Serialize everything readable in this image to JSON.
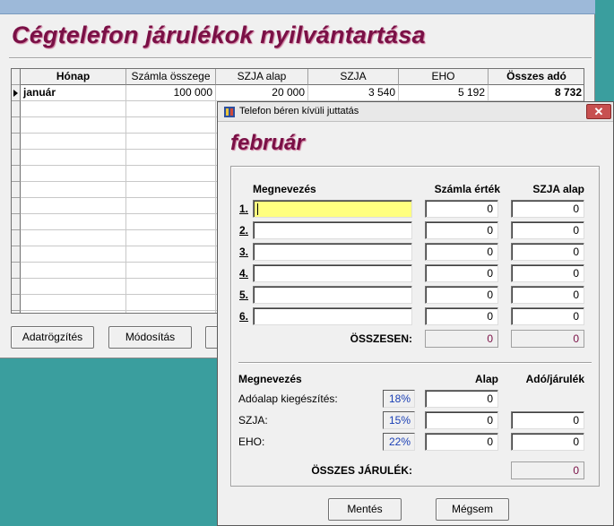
{
  "main": {
    "title": "Cégtelefon járulékok nyilvántartása",
    "columns": [
      "Hónap",
      "Számla összege",
      "SZJA alap",
      "SZJA",
      "EHO",
      "Összes adó"
    ],
    "rows": [
      {
        "honap": "január",
        "szamla": "100 000",
        "szja_alap": "20 000",
        "szja": "3 540",
        "eho": "5 192",
        "osszes": "8 732"
      }
    ],
    "buttons": {
      "adatrogzites": "Adatrögzítés",
      "modositas": "Módosítás"
    }
  },
  "dialog": {
    "title": "Telefon béren kívüli juttatás",
    "month": "február",
    "close_label": "✕",
    "items": {
      "header_name": "Megnevezés",
      "header_value": "Számla érték",
      "header_base": "SZJA alap",
      "rows": [
        {
          "num": "1.",
          "name": "",
          "value": "0",
          "base": "0"
        },
        {
          "num": "2.",
          "name": "",
          "value": "0",
          "base": "0"
        },
        {
          "num": "3.",
          "name": "",
          "value": "0",
          "base": "0"
        },
        {
          "num": "4.",
          "name": "",
          "value": "0",
          "base": "0"
        },
        {
          "num": "5.",
          "name": "",
          "value": "0",
          "base": "0"
        },
        {
          "num": "6.",
          "name": "",
          "value": "0",
          "base": "0"
        }
      ],
      "total_label": "ÖSSZESEN:",
      "total_value": "0",
      "total_base": "0"
    },
    "tax": {
      "header_name": "Megnevezés",
      "header_base": "Alap",
      "header_tax": "Adó/járulék",
      "rows": [
        {
          "label": "Adóalap kiegészítés:",
          "pct": "18%",
          "base": "0"
        },
        {
          "label": "SZJA:",
          "pct": "15%",
          "base": "0",
          "tax": "0"
        },
        {
          "label": "EHO:",
          "pct": "22%",
          "base": "0",
          "tax": "0"
        }
      ],
      "total_label": "ÖSSZES JÁRULÉK:",
      "total_value": "0"
    },
    "buttons": {
      "save": "Mentés",
      "cancel": "Mégsem"
    }
  }
}
